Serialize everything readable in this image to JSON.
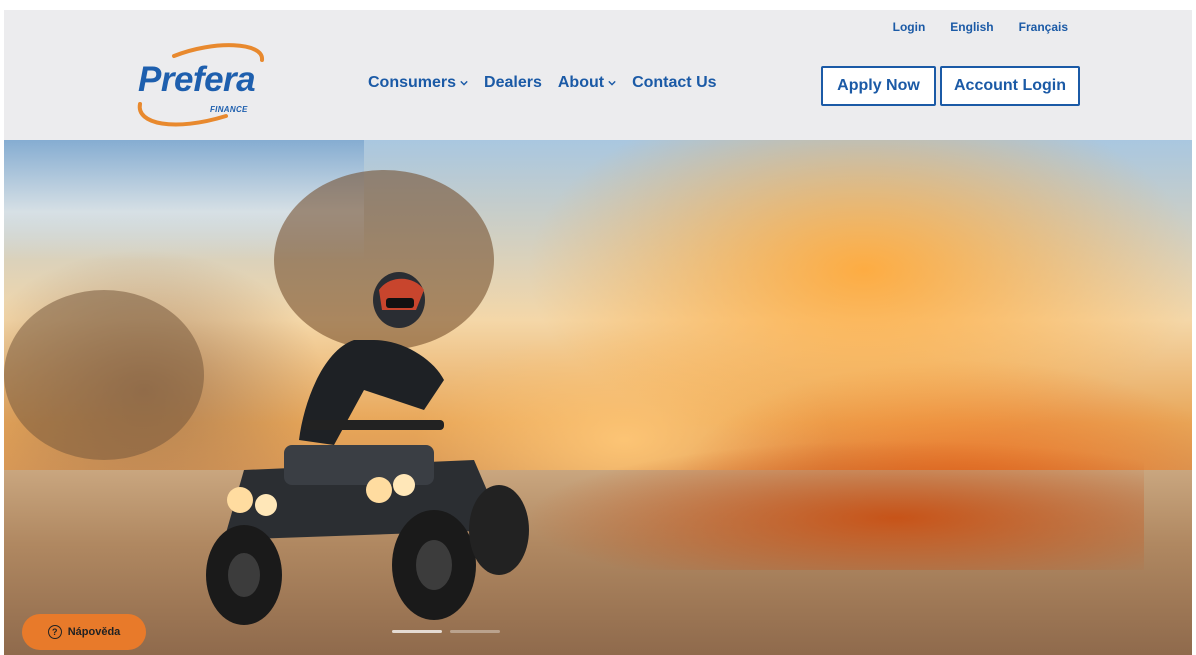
{
  "utility_nav": {
    "login": "Login",
    "english": "English",
    "french": "Français"
  },
  "logo": {
    "name": "Prefera",
    "sub": "FINANCE"
  },
  "main_nav": [
    {
      "label": "Consumers",
      "has_dropdown": true
    },
    {
      "label": "Dealers",
      "has_dropdown": false
    },
    {
      "label": "About",
      "has_dropdown": true
    },
    {
      "label": "Contact Us",
      "has_dropdown": false
    }
  ],
  "buttons": {
    "apply_now": "Apply Now",
    "account_login": "Account Login"
  },
  "help": {
    "label": "Nápověda",
    "icon": "question-circle-icon"
  },
  "colors": {
    "brand_blue": "#1b5aa6",
    "logo_orange": "#e8892e",
    "help_orange": "#e87a2a",
    "header_bg": "#ececee"
  }
}
